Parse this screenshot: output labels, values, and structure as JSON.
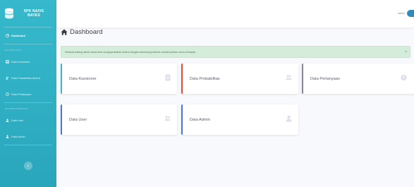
{
  "brand": {
    "name": "SPK NAIVE BAYES",
    "icon": "database-icon"
  },
  "sidebar": {
    "dashboard": "Dashboard",
    "heading_data": "MASTER DATA",
    "items": [
      {
        "label": "Data Kuesioner",
        "icon": "table-icon"
      },
      {
        "label": "Data Probabilitas Atribut",
        "icon": "users-icon"
      },
      {
        "label": "Data Pertanyaan",
        "icon": "question-icon"
      }
    ],
    "heading_users": "MASTER PENGGUNA",
    "user_items": [
      {
        "label": "Data User",
        "icon": "user-icon"
      },
      {
        "label": "Data Admin",
        "icon": "user-icon"
      }
    ],
    "toggle_icon": "chevron-left-icon"
  },
  "topbar": {
    "user_name": "admin",
    "avatar_color": "#2e8bbd"
  },
  "page": {
    "title": "Dashboard",
    "title_icon": "home-icon"
  },
  "alert": {
    "text": "Selamat datang admin Anda bisa mengoperasikan sistem dengan wewenang tertentu melalui pilihan menu di bawah.",
    "close": "×"
  },
  "cards": [
    {
      "label": "Data Kuesioner",
      "color": "#36b9cc",
      "icon": "file-icon"
    },
    {
      "label": "Data Probabilitas",
      "color": "#e74a3b",
      "icon": "users-icon"
    },
    {
      "label": "Data Pertanyaan",
      "color": "#858796",
      "icon": "question-circle-icon"
    },
    {
      "label": "Data User",
      "color": "#4e73df",
      "icon": "users-icon"
    },
    {
      "label": "Data Admin",
      "color": "#4e73df",
      "icon": "user-icon"
    }
  ]
}
